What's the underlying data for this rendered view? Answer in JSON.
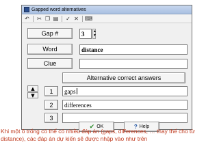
{
  "window": {
    "title": "Gapped word alternatives"
  },
  "toolbar": {
    "icons": [
      "undo-icon",
      "cut-icon",
      "copy-icon",
      "paste-icon",
      "check-icon",
      "clear-icon",
      "keyboard-icon"
    ]
  },
  "form": {
    "gap_label": "Gap #",
    "gap_value": "3",
    "word_label": "Word",
    "word_value": "distance",
    "clue_label": "Clue",
    "clue_value": ""
  },
  "alternatives": {
    "header": "Alternative correct answers",
    "rows": [
      {
        "number": "1",
        "value": "gaps"
      },
      {
        "number": "2",
        "value": "differences"
      },
      {
        "number": "3",
        "value": ""
      }
    ]
  },
  "buttons": {
    "ok_label": "OK",
    "help_label": "Help"
  },
  "caption": "Khi một ô trống có thể có nhiều đáp án (gaps, differences, … thay thế cho từ distance), các đáp án dự kiến sẽ được nhập vào như trên"
}
